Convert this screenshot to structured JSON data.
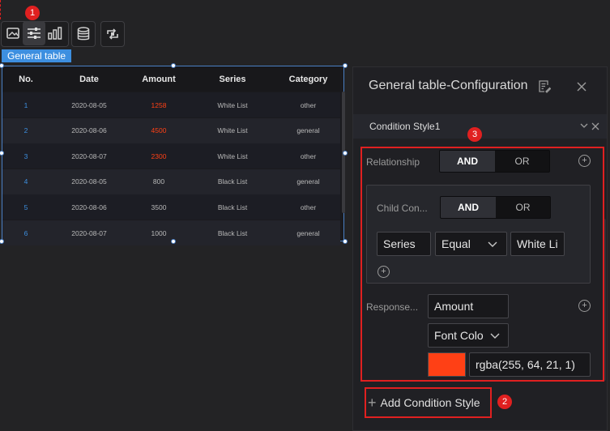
{
  "toolbar": {
    "badge1": "1",
    "icons": [
      "image-icon",
      "sliders-icon",
      "bar-chart-icon",
      "database-icon",
      "refresh-link-icon"
    ]
  },
  "widget": {
    "label": "General table"
  },
  "table": {
    "headers": [
      "No.",
      "Date",
      "Amount",
      "Series",
      "Category"
    ],
    "rows": [
      {
        "no": "1",
        "date": "2020-08-05",
        "amount": "1258",
        "series": "White List",
        "category": "other",
        "highlight": true
      },
      {
        "no": "2",
        "date": "2020-08-06",
        "amount": "4500",
        "series": "White List",
        "category": "general",
        "highlight": true
      },
      {
        "no": "3",
        "date": "2020-08-07",
        "amount": "2300",
        "series": "White List",
        "category": "other",
        "highlight": true
      },
      {
        "no": "4",
        "date": "2020-08-05",
        "amount": "800",
        "series": "Black List",
        "category": "general",
        "highlight": false
      },
      {
        "no": "5",
        "date": "2020-08-06",
        "amount": "3500",
        "series": "Black List",
        "category": "other",
        "highlight": false
      },
      {
        "no": "6",
        "date": "2020-08-07",
        "amount": "1000",
        "series": "Black List",
        "category": "general",
        "highlight": false
      }
    ],
    "highlight_color": "#ff4015"
  },
  "panel": {
    "title": "General table-Configuration",
    "section_title": "Condition Style1",
    "badge3": "3",
    "relationship_label": "Relationship",
    "relationship_options": [
      "AND",
      "OR"
    ],
    "relationship_selected": "AND",
    "child_label": "Child Con...",
    "child_options": [
      "AND",
      "OR"
    ],
    "child_selected": "AND",
    "condition": {
      "field": "Series",
      "operator": "Equal",
      "value": "White Li"
    },
    "response_label": "Response...",
    "response_field": "Amount",
    "response_property": "Font Colo",
    "color_swatch": "#ff4015",
    "color_value": "rgba(255, 64, 21, 1)",
    "add_label": "Add Condition Style",
    "badge2": "2"
  }
}
